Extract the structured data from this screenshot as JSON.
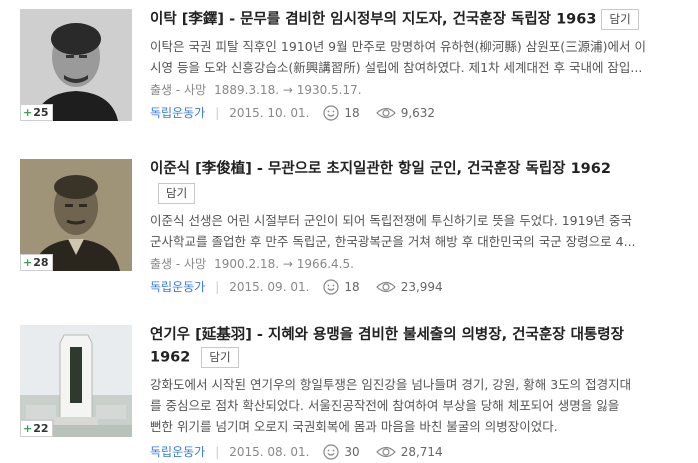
{
  "entries": [
    {
      "title": "이탁",
      "hanja": "[李鐸]",
      "subtitle": " - 문무를 겸비한 임시정부의 지도자, 건국훈장 독립장 1963",
      "save_label": "담기",
      "desc_line1": "이탁은 국권 피탈 직후인 1910년 9월 만주로 망명하여 유하현(柳河縣) 삼원포(三源浦)에서 이",
      "desc_line2": "시영 등을 도와 신흥강습소(新興講習所) 설립에 참여하였다. 제1차 세계대전 후 국내에 잠입...",
      "life_label": "출생 - 사망",
      "life_dates": "1889.3.18. → 1930.5.17.",
      "category": "독립운동가",
      "date": "2015. 10. 01.",
      "likes": "18",
      "views": "9,632",
      "badge_plus": "+",
      "badge_count": "25"
    },
    {
      "title": "이준식",
      "hanja": "[李俊植]",
      "subtitle": " - 무관으로 초지일관한 항일 군인, 건국훈장 독립장 1962",
      "save_label": "담기",
      "desc_line1": "이준식 선생은 어린 시절부터 군인이 되어 독립전쟁에 투신하기로 뜻을 두었다. 1919년 중국",
      "desc_line2": "군사학교를 졸업한 후 만주 독립군, 한국광복군을 거쳐 해방 후 대한민국의 국군 장령으로 4...",
      "life_label": "출생 - 사망",
      "life_dates": "1900.2.18. → 1966.4.5.",
      "category": "독립운동가",
      "date": "2015. 09. 01.",
      "likes": "18",
      "views": "23,994",
      "badge_plus": "+",
      "badge_count": "28"
    },
    {
      "title": "연기우",
      "hanja": "[延基羽]",
      "subtitle": " - 지혜와 용맹을 겸비한 불세출의 의병장, 건국훈장 대통령장",
      "subtitle2": "1962",
      "save_label": "담기",
      "desc_line1": "강화도에서 시작된 연기우의 항일투쟁은 임진강을 넘나들며 경기, 강원, 황해 3도의 접경지대",
      "desc_line2": "를 중심으로 점차 확산되었다. 서울진공작전에 참여하여 부상을 당해 체포되어 생명을 잃을",
      "desc_line3": "뻔한 위기를 넘기며 오로지 국권회복에 몸과 마음을 바친 불굴의 의병장이었다.",
      "category": "독립운동가",
      "date": "2015. 08. 01.",
      "likes": "30",
      "views": "28,714",
      "badge_plus": "+",
      "badge_count": "22"
    }
  ],
  "icons": {
    "like": "smile-icon",
    "view": "eye-icon"
  },
  "colors": {
    "category_link": "#3a7bd5",
    "badge_plus": "#3aa14a"
  }
}
